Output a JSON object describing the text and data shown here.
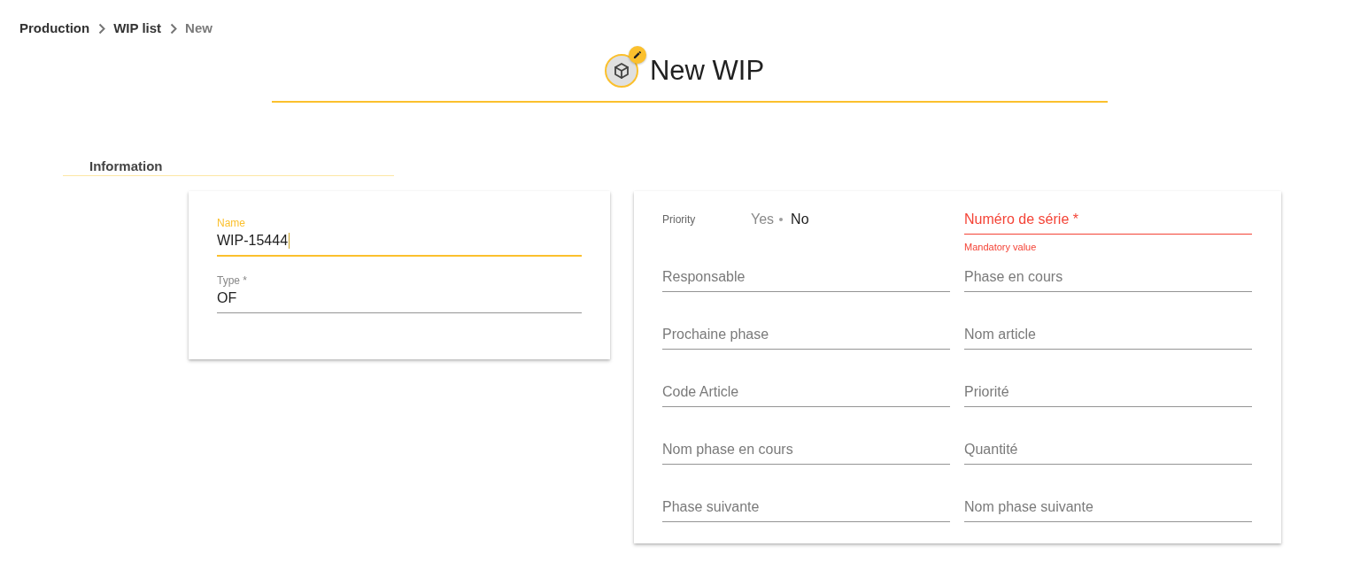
{
  "breadcrumb": [
    {
      "label": "Production",
      "current": false
    },
    {
      "label": "WIP list",
      "current": false
    },
    {
      "label": "New",
      "current": true
    }
  ],
  "header": {
    "title": "New WIP"
  },
  "section": {
    "title": "Information"
  },
  "main_card": {
    "fields": [
      {
        "label": "Name",
        "value": "WIP-15444",
        "focused": true
      },
      {
        "label": "Type *",
        "value": "OF",
        "focused": false
      }
    ]
  },
  "details_card": {
    "items": [
      {
        "kind": "toggle",
        "label": "Priority",
        "options": [
          {
            "label": "Yes",
            "selected": false
          },
          {
            "label": "No",
            "selected": true
          }
        ]
      },
      {
        "kind": "text",
        "placeholder": "Numéro de série *",
        "invalid": true,
        "error": "Mandatory value"
      },
      {
        "kind": "text",
        "placeholder": "Responsable",
        "invalid": false
      },
      {
        "kind": "text",
        "placeholder": "Phase en cours",
        "invalid": false
      },
      {
        "kind": "text",
        "placeholder": "Prochaine phase",
        "invalid": false
      },
      {
        "kind": "text",
        "placeholder": "Nom article",
        "invalid": false
      },
      {
        "kind": "text",
        "placeholder": "Code Article",
        "invalid": false
      },
      {
        "kind": "text",
        "placeholder": "Priorité",
        "invalid": false
      },
      {
        "kind": "text",
        "placeholder": "Nom phase en cours",
        "invalid": false
      },
      {
        "kind": "text",
        "placeholder": "Quantité",
        "invalid": false
      },
      {
        "kind": "text",
        "placeholder": "Phase suivante",
        "invalid": false
      },
      {
        "kind": "text",
        "placeholder": "Nom phase suivante",
        "invalid": false
      }
    ]
  }
}
